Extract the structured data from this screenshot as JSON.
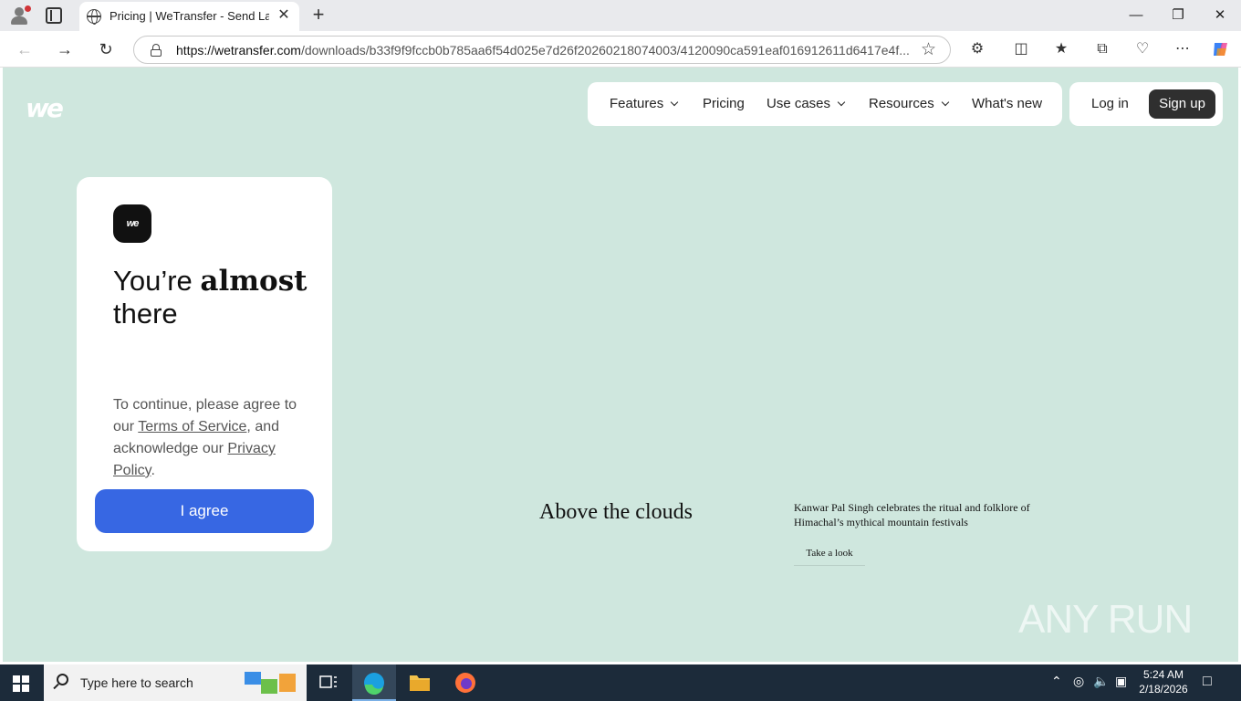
{
  "browser": {
    "tab_title": "Pricing | WeTransfer - Send Large",
    "tab_close": "✕",
    "new_tab": "+",
    "url_host": "https://wetransfer.com",
    "url_path": "/downloads/b33f9f9fccb0b785aa6f54d025e7d26f20260218074003/4120090ca591eaf016912611d6417e4f...",
    "window_controls": {
      "minimize": "—",
      "restore": "❐",
      "close": "✕"
    },
    "icons": [
      "profile-icon",
      "tab-actions-icon",
      "back-icon",
      "forward-icon",
      "refresh-icon",
      "lock-icon",
      "favorite-star-icon",
      "extensions-icon",
      "split-screen-icon",
      "favorites-icon",
      "collections-icon",
      "performance-icon",
      "more-icon",
      "copilot-icon"
    ]
  },
  "site": {
    "logo": "we",
    "nav": {
      "features": "Features",
      "pricing": "Pricing",
      "use_cases": "Use cases",
      "resources": "Resources",
      "whats_new": "What's new"
    },
    "auth": {
      "login": "Log in",
      "signup": "Sign up"
    }
  },
  "card": {
    "logo": "we",
    "heading_pre": "You’re ",
    "heading_strong": "almost",
    "heading_post": "there",
    "text_1": "To continue, please agree to our ",
    "terms_link": "Terms of Service",
    "text_2": ", and acknowledge our ",
    "privacy_link": "Privacy Policy",
    "text_3": ".",
    "agree_button": "I agree"
  },
  "story": {
    "title": "Above the clouds",
    "description": "Kanwar Pal Singh celebrates the ritual and folklore of Himachal’s mythical mountain festivals",
    "cta": "Take a look"
  },
  "watermark": "ANY RUN",
  "taskbar": {
    "search_placeholder": "Type here to search",
    "time": "5:24 AM",
    "date": "2/18/2026",
    "apps": [
      "task-view-icon",
      "edge-icon",
      "file-explorer-icon",
      "firefox-icon"
    ]
  },
  "colors": {
    "page_bg": "#cfe7de",
    "agree_button": "#3767e3",
    "signup_button": "#2f2f2f",
    "taskbar": "#1c2b3a"
  }
}
